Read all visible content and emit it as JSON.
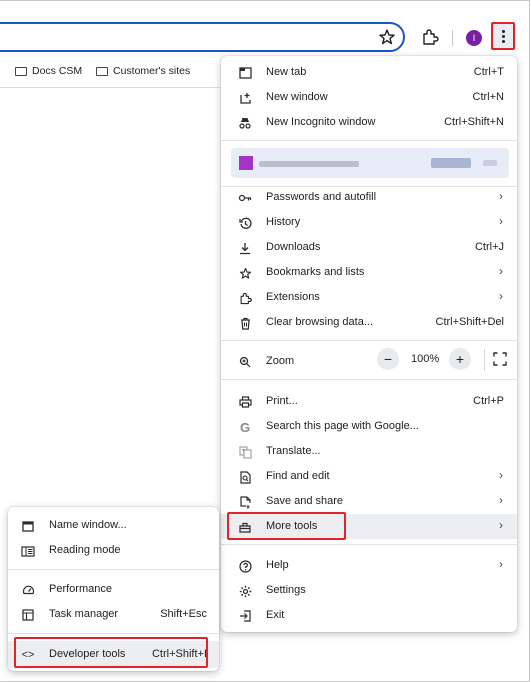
{
  "toolbar": {
    "avatar_initial": "I",
    "icons": [
      "star-icon",
      "extensions-icon",
      "kebab-menu-icon"
    ]
  },
  "bookmarks": [
    {
      "label": "Docs CSM"
    },
    {
      "label": "Customer's sites"
    }
  ],
  "menu": {
    "items": [
      {
        "label": "New tab",
        "shortcut": "Ctrl+T",
        "icon": "new-tab-icon"
      },
      {
        "label": "New window",
        "shortcut": "Ctrl+N",
        "icon": "new-window-icon"
      },
      {
        "label": "New Incognito window",
        "shortcut": "Ctrl+Shift+N",
        "icon": "incognito-icon"
      },
      {
        "label": "Passwords and autofill",
        "shortcut": "",
        "icon": "key-icon"
      },
      {
        "label": "History",
        "shortcut": "",
        "icon": "history-icon"
      },
      {
        "label": "Downloads",
        "shortcut": "Ctrl+J",
        "icon": "download-icon"
      },
      {
        "label": "Bookmarks and lists",
        "shortcut": "",
        "icon": "star-icon"
      },
      {
        "label": "Extensions",
        "shortcut": "",
        "icon": "extensions-icon"
      },
      {
        "label": "Clear browsing data...",
        "shortcut": "Ctrl+Shift+Del",
        "icon": "trash-icon"
      },
      {
        "label": "Zoom",
        "shortcut": "",
        "icon": "zoom-icon"
      },
      {
        "label": "Print...",
        "shortcut": "Ctrl+P",
        "icon": "print-icon"
      },
      {
        "label": "Search this page with Google...",
        "shortcut": "",
        "icon": "google-icon"
      },
      {
        "label": "Translate...",
        "shortcut": "",
        "icon": "translate-icon"
      },
      {
        "label": "Find and edit",
        "shortcut": "",
        "icon": "find-icon"
      },
      {
        "label": "Save and share",
        "shortcut": "",
        "icon": "save-share-icon"
      },
      {
        "label": "More tools",
        "shortcut": "",
        "icon": "toolbox-icon"
      },
      {
        "label": "Help",
        "shortcut": "",
        "icon": "help-icon"
      },
      {
        "label": "Settings",
        "shortcut": "",
        "icon": "gear-icon"
      },
      {
        "label": "Exit",
        "shortcut": "",
        "icon": "exit-icon"
      }
    ],
    "zoom_value": "100%"
  },
  "submenu": {
    "items": [
      {
        "label": "Name window...",
        "shortcut": "",
        "icon": "window-icon"
      },
      {
        "label": "Reading mode",
        "shortcut": "",
        "icon": "reading-mode-icon"
      },
      {
        "label": "Performance",
        "shortcut": "",
        "icon": "performance-icon"
      },
      {
        "label": "Task manager",
        "shortcut": "Shift+Esc",
        "icon": "task-manager-icon"
      },
      {
        "label": "Developer tools",
        "shortcut": "Ctrl+Shift+I",
        "icon": "code-icon"
      }
    ]
  },
  "colors": {
    "highlight_box": "#e0242a",
    "omnibox_border": "#1a56c7",
    "avatar_bg": "#7b1fa2",
    "hover_bg": "#eceef2"
  }
}
